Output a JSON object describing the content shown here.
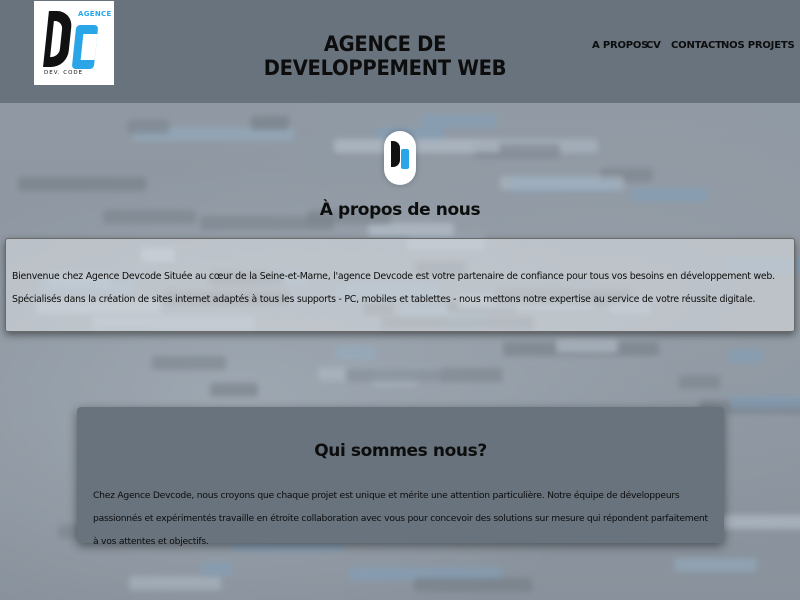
{
  "header": {
    "logo": {
      "agence": "AGENCE",
      "letters": "DC",
      "tagline": "DEV. CODE"
    },
    "title": "AGENCE DE DEVELOPPEMENT WEB",
    "nav": [
      {
        "label": "A PROPOS"
      },
      {
        "label": "CV"
      },
      {
        "label": "CONTACT"
      },
      {
        "label": "NOS PROJETS"
      }
    ]
  },
  "about": {
    "title": "À propos de nous",
    "text": "Bienvenue chez Agence Devcode Située au cœur de la Seine-et-Marne, l'agence Devcode est votre partenaire de confiance pour tous vos besoins en développement web. Spécialisés dans la création de sites internet adaptés à tous les supports - PC, mobiles et tablettes - nous mettons notre expertise au service de votre réussite digitale."
  },
  "who": {
    "title": "Qui sommes nous?",
    "text": "Chez Agence Devcode, nous croyons que chaque projet est unique et mérite une attention particulière. Notre équipe de développeurs passionnés et expérimentés travaille en étroite collaboration avec vous pour concevoir des solutions sur mesure qui répondent parfaitement à vos attentes et objectifs."
  },
  "colors": {
    "header_bg": "#68737d",
    "logo_accent": "#2aa6e8",
    "card_bg": "#68737d",
    "text": "#0d0d0d"
  }
}
